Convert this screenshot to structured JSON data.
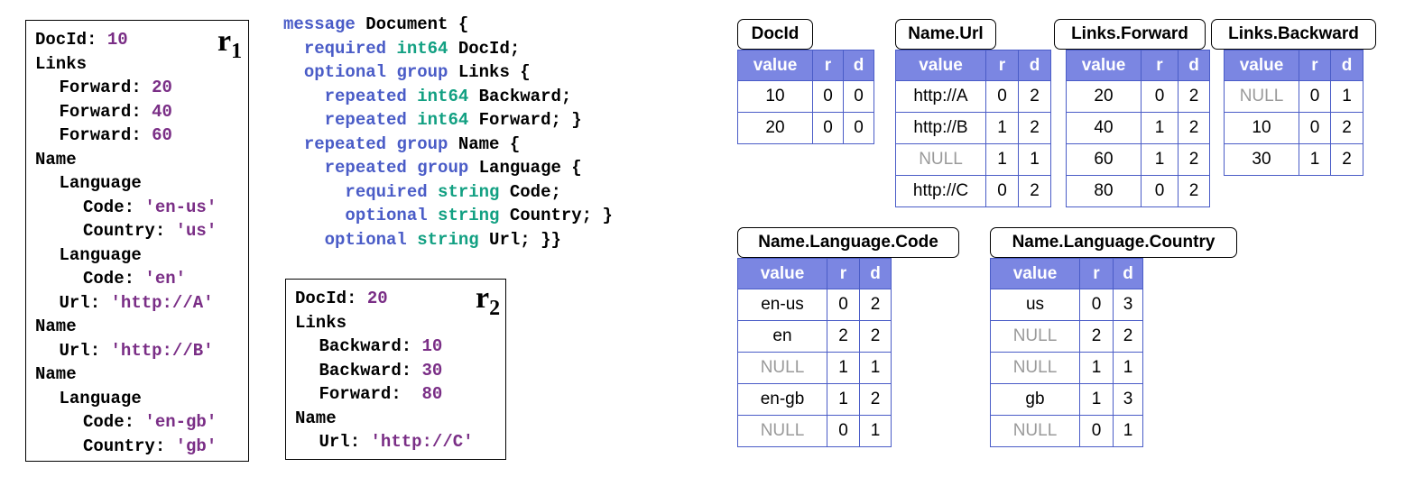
{
  "records": [
    {
      "tag_letter": "r",
      "tag_sub": "1",
      "lines": [
        {
          "indent": 0,
          "field": "DocId:",
          "value": "10"
        },
        {
          "indent": 0,
          "field": "Links",
          "value": ""
        },
        {
          "indent": 1,
          "field": "Forward:",
          "value": "20"
        },
        {
          "indent": 1,
          "field": "Forward:",
          "value": "40"
        },
        {
          "indent": 1,
          "field": "Forward:",
          "value": "60"
        },
        {
          "indent": 0,
          "field": "Name",
          "value": ""
        },
        {
          "indent": 1,
          "field": "Language",
          "value": ""
        },
        {
          "indent": 2,
          "field": "Code:",
          "value": "'en-us'"
        },
        {
          "indent": 2,
          "field": "Country:",
          "value": "'us'"
        },
        {
          "indent": 1,
          "field": "Language",
          "value": ""
        },
        {
          "indent": 2,
          "field": "Code:",
          "value": "'en'"
        },
        {
          "indent": 1,
          "field": "Url:",
          "value": "'http://A'"
        },
        {
          "indent": 0,
          "field": "Name",
          "value": ""
        },
        {
          "indent": 1,
          "field": "Url:",
          "value": "'http://B'"
        },
        {
          "indent": 0,
          "field": "Name",
          "value": ""
        },
        {
          "indent": 1,
          "field": "Language",
          "value": ""
        },
        {
          "indent": 2,
          "field": "Code:",
          "value": "'en-gb'"
        },
        {
          "indent": 2,
          "field": "Country:",
          "value": "'gb'"
        }
      ]
    },
    {
      "tag_letter": "r",
      "tag_sub": "2",
      "lines": [
        {
          "indent": 0,
          "field": "DocId:",
          "value": "20"
        },
        {
          "indent": 0,
          "field": "Links",
          "value": ""
        },
        {
          "indent": 1,
          "field": "Backward:",
          "value": "10"
        },
        {
          "indent": 1,
          "field": "Backward:",
          "value": "30"
        },
        {
          "indent": 1,
          "field": "Forward: ",
          "value": "80"
        },
        {
          "indent": 0,
          "field": "Name",
          "value": ""
        },
        {
          "indent": 1,
          "field": "Url:",
          "value": "'http://C'"
        }
      ]
    }
  ],
  "schema": [
    [
      {
        "t": "kw",
        "s": "message"
      },
      {
        "t": "id",
        "s": " Document {"
      }
    ],
    [
      {
        "t": "id",
        "s": "  "
      },
      {
        "t": "kw",
        "s": "required"
      },
      {
        "t": "id",
        "s": " "
      },
      {
        "t": "ty",
        "s": "int64"
      },
      {
        "t": "id",
        "s": " DocId;"
      }
    ],
    [
      {
        "t": "id",
        "s": "  "
      },
      {
        "t": "kw",
        "s": "optional"
      },
      {
        "t": "id",
        "s": " "
      },
      {
        "t": "kw",
        "s": "group"
      },
      {
        "t": "id",
        "s": " Links {"
      }
    ],
    [
      {
        "t": "id",
        "s": "    "
      },
      {
        "t": "kw",
        "s": "repeated"
      },
      {
        "t": "id",
        "s": " "
      },
      {
        "t": "ty",
        "s": "int64"
      },
      {
        "t": "id",
        "s": " Backward;"
      }
    ],
    [
      {
        "t": "id",
        "s": "    "
      },
      {
        "t": "kw",
        "s": "repeated"
      },
      {
        "t": "id",
        "s": " "
      },
      {
        "t": "ty",
        "s": "int64"
      },
      {
        "t": "id",
        "s": " Forward; }"
      }
    ],
    [
      {
        "t": "id",
        "s": "  "
      },
      {
        "t": "kw",
        "s": "repeated"
      },
      {
        "t": "id",
        "s": " "
      },
      {
        "t": "kw",
        "s": "group"
      },
      {
        "t": "id",
        "s": " Name {"
      }
    ],
    [
      {
        "t": "id",
        "s": "    "
      },
      {
        "t": "kw",
        "s": "repeated"
      },
      {
        "t": "id",
        "s": " "
      },
      {
        "t": "kw",
        "s": "group"
      },
      {
        "t": "id",
        "s": " Language {"
      }
    ],
    [
      {
        "t": "id",
        "s": "      "
      },
      {
        "t": "kw",
        "s": "required"
      },
      {
        "t": "id",
        "s": " "
      },
      {
        "t": "ty",
        "s": "string"
      },
      {
        "t": "id",
        "s": " Code;"
      }
    ],
    [
      {
        "t": "id",
        "s": "      "
      },
      {
        "t": "kw",
        "s": "optional"
      },
      {
        "t": "id",
        "s": " "
      },
      {
        "t": "ty",
        "s": "string"
      },
      {
        "t": "id",
        "s": " Country; }"
      }
    ],
    [
      {
        "t": "id",
        "s": "    "
      },
      {
        "t": "kw",
        "s": "optional"
      },
      {
        "t": "id",
        "s": " "
      },
      {
        "t": "ty",
        "s": "string"
      },
      {
        "t": "id",
        "s": " Url; }}"
      }
    ]
  ],
  "columns": [
    {
      "title": "DocId",
      "headers": [
        "value",
        "r",
        "d"
      ],
      "rows": [
        [
          "10",
          "0",
          "0"
        ],
        [
          "20",
          "0",
          "0"
        ]
      ]
    },
    {
      "title": "Name.Url",
      "headers": [
        "value",
        "r",
        "d"
      ],
      "rows": [
        [
          "http://A",
          "0",
          "2"
        ],
        [
          "http://B",
          "1",
          "2"
        ],
        [
          "NULL",
          "1",
          "1"
        ],
        [
          "http://C",
          "0",
          "2"
        ]
      ]
    },
    {
      "title": "Links.Forward",
      "headers": [
        "value",
        "r",
        "d"
      ],
      "rows": [
        [
          "20",
          "0",
          "2"
        ],
        [
          "40",
          "1",
          "2"
        ],
        [
          "60",
          "1",
          "2"
        ],
        [
          "80",
          "0",
          "2"
        ]
      ]
    },
    {
      "title": "Links.Backward",
      "headers": [
        "value",
        "r",
        "d"
      ],
      "rows": [
        [
          "NULL",
          "0",
          "1"
        ],
        [
          "10",
          "0",
          "2"
        ],
        [
          "30",
          "1",
          "2"
        ]
      ]
    },
    {
      "title": "Name.Language.Code",
      "headers": [
        "value",
        "r",
        "d"
      ],
      "rows": [
        [
          "en-us",
          "0",
          "2"
        ],
        [
          "en",
          "2",
          "2"
        ],
        [
          "NULL",
          "1",
          "1"
        ],
        [
          "en-gb",
          "1",
          "2"
        ],
        [
          "NULL",
          "0",
          "1"
        ]
      ]
    },
    {
      "title": "Name.Language.Country",
      "headers": [
        "value",
        "r",
        "d"
      ],
      "rows": [
        [
          "us",
          "0",
          "3"
        ],
        [
          "NULL",
          "2",
          "2"
        ],
        [
          "NULL",
          "1",
          "1"
        ],
        [
          "gb",
          "1",
          "3"
        ],
        [
          "NULL",
          "0",
          "1"
        ]
      ]
    }
  ],
  "colors": {
    "keyword": "#4a5cc7",
    "type": "#12a082",
    "value": "#7a2e86",
    "header_bg": "#7b86e2",
    "null_text": "#9a9a9a"
  }
}
